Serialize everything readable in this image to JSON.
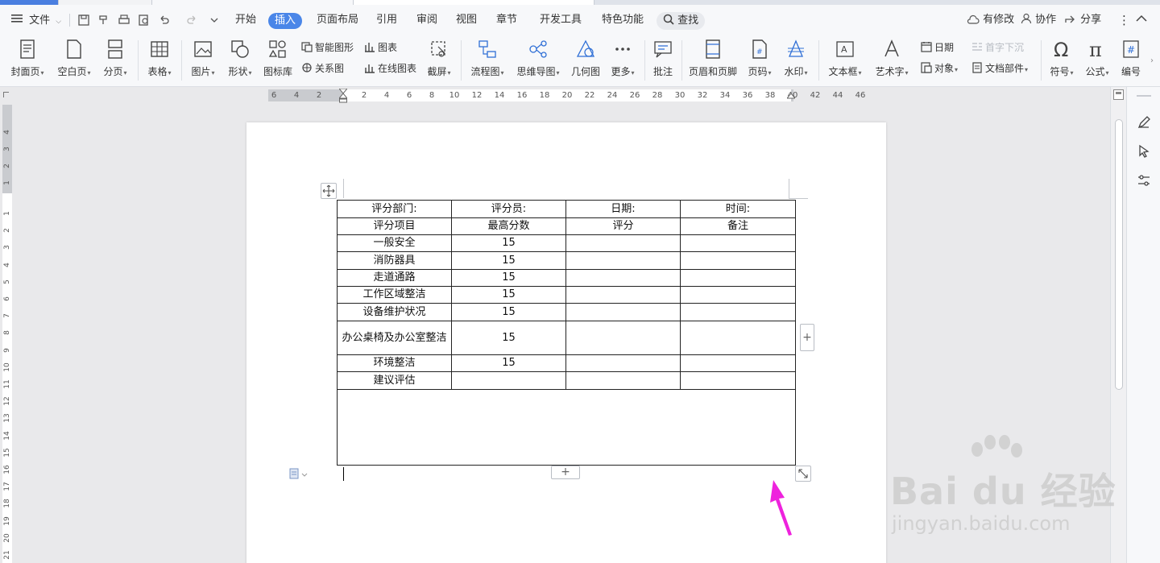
{
  "menu": {
    "file_label": "文件",
    "tabs": [
      "开始",
      "插入",
      "页面布局",
      "引用",
      "审阅",
      "视图",
      "章节",
      "开发工具",
      "特色功能"
    ],
    "active_tab": "插入",
    "search_label": "查找",
    "right": {
      "changes": "有修改",
      "collab": "协作",
      "share": "分享"
    }
  },
  "ribbon": {
    "cover": "封面页",
    "blank": "空白页",
    "pagebreak": "分页",
    "table": "表格",
    "picture": "图片",
    "shape": "形状",
    "iconlib": "图标库",
    "smartart": "智能图形",
    "chart": "图表",
    "relation": "关系图",
    "online_chart": "在线图表",
    "screenshot": "截屏",
    "flowchart": "流程图",
    "mindmap": "思维导图",
    "geometry": "几何图",
    "more": "更多",
    "comment": "批注",
    "header_footer": "页眉和页脚",
    "page_number": "页码",
    "watermark": "水印",
    "textbox": "文本框",
    "wordart": "艺术字",
    "date": "日期",
    "object": "对象",
    "dropcap": "首字下沉",
    "docpart": "文档部件",
    "symbol": "符号",
    "formula": "公式",
    "numbering": "编号"
  },
  "ruler": {
    "h_ticks": [
      "6",
      "4",
      "2",
      "2",
      "4",
      "6",
      "8",
      "10",
      "12",
      "14",
      "16",
      "18",
      "20",
      "22",
      "24",
      "26",
      "28",
      "30",
      "32",
      "34",
      "36",
      "38",
      "40",
      "42",
      "44",
      "46"
    ],
    "v_ticks_top": [
      "4",
      "3",
      "2",
      "1"
    ],
    "v_ticks": [
      "1",
      "2",
      "3",
      "4",
      "5",
      "6",
      "7",
      "8",
      "9",
      "10",
      "11",
      "12",
      "13",
      "14",
      "15",
      "16",
      "17",
      "18",
      "19",
      "20",
      "21"
    ]
  },
  "table": {
    "header_row": [
      "评分部门:",
      "评分员:",
      "日期:",
      "时间:"
    ],
    "column_row": [
      "评分项目",
      "最高分数",
      "评分",
      "备注"
    ],
    "rows": [
      {
        "item": "一般安全",
        "max": "15",
        "score": "",
        "note": ""
      },
      {
        "item": "消防器具",
        "max": "15",
        "score": "",
        "note": ""
      },
      {
        "item": "走道通路",
        "max": "15",
        "score": "",
        "note": ""
      },
      {
        "item": "工作区域整洁",
        "max": "15",
        "score": "",
        "note": ""
      },
      {
        "item": "设备维护状况",
        "max": "15",
        "score": "",
        "note": ""
      },
      {
        "item": "办公桌椅及办公室整洁",
        "max": "15",
        "score": "",
        "note": ""
      },
      {
        "item": "环境整洁",
        "max": "15",
        "score": "",
        "note": ""
      },
      {
        "item": "建议评估",
        "max": "",
        "score": "",
        "note": ""
      }
    ],
    "footer_blank": ""
  },
  "watermark": {
    "big": "Bai du 经验",
    "small": "jingyan.baidu.com"
  },
  "colors": {
    "accent": "#4a86e8",
    "arrow": "#ee22dd"
  }
}
